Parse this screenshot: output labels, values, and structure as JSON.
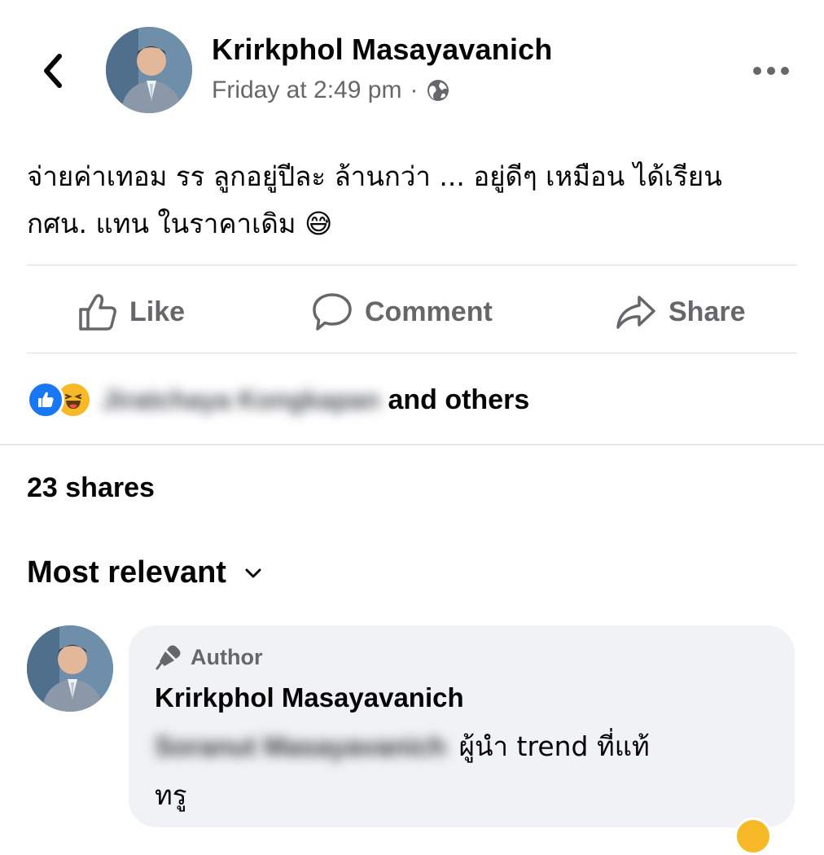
{
  "header": {
    "author_name": "Krirkphol Masayavanich",
    "timestamp": "Friday at 2:49 pm",
    "separator": "·",
    "privacy_icon": "globe-icon",
    "back_icon": "chevron-left-icon",
    "more_icon": "more-horizontal-icon"
  },
  "post": {
    "text_line1": "จ่ายค่าเทอม รร ลูกอยู่ปีละ ล้านกว่า ... อยู่ดีๆ เหมือน ได้เรียน",
    "text_line2": "กศน. แทน ในราคาเดิม",
    "emoji": "😅"
  },
  "actions": {
    "like": "Like",
    "comment": "Comment",
    "share": "Share"
  },
  "reactions": {
    "types": [
      "like",
      "haha"
    ],
    "names_blurred": "Jiratchaya Kongkapan",
    "suffix": "and others"
  },
  "shares": "23 shares",
  "sort": {
    "label": "Most relevant"
  },
  "comments": [
    {
      "badge": "Author",
      "author": "Krirkphol Masayavanich",
      "tagged_blurred": "Soranut Masayavanich",
      "text_line1": "ผู้นำ trend ที่แท้",
      "text_line2": "ทรู"
    }
  ],
  "colors": {
    "text": "#050505",
    "secondary": "#65676b",
    "like_blue": "#1877f2",
    "haha_yellow": "#f7b928",
    "bubble": "#f0f2f5",
    "divider": "#dadde1"
  }
}
